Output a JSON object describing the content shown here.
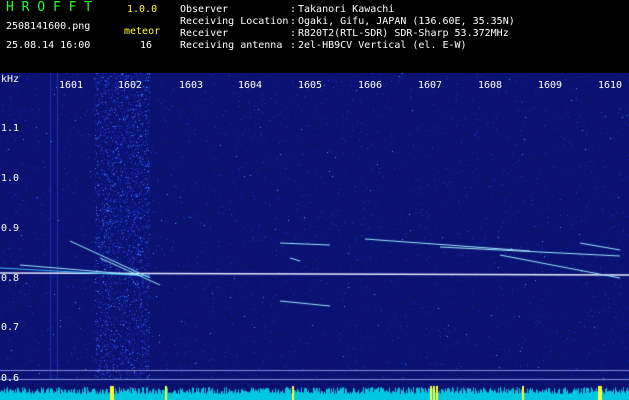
{
  "header": {
    "app_name": "H R O F F T",
    "version": "1.0.0",
    "file_name": "2508141600.png",
    "date_time": "25.08.14 16:00",
    "meteor_label": "meteor",
    "meteor_count": "16"
  },
  "info": [
    {
      "label": "Observer",
      "value": "Takanori Kawachi"
    },
    {
      "label": "Receiving Location",
      "value": "Ogaki, Gifu, JAPAN (136.60E, 35.35N)"
    },
    {
      "label": "Receiver",
      "value": "R820T2(RTL-SDR) SDR-Sharp 53.372MHz"
    },
    {
      "label": "Receiving antenna",
      "value": "2el-HB9CV Vertical (el. E-W)"
    }
  ],
  "separator": ":",
  "axis": {
    "y_unit": "kHz",
    "x_ticks": [
      "1601",
      "1602",
      "1603",
      "1604",
      "1605",
      "1606",
      "1607",
      "1608",
      "1609",
      "1610"
    ],
    "y_ticks": [
      "1.1",
      "1.0",
      "0.9",
      "0.8",
      "0.7",
      "0.6"
    ]
  },
  "colors": {
    "background": "#000000",
    "title": "#22ff22",
    "accent": "#ffff33",
    "text": "#ffffff",
    "spectrum_base": "#0a1170",
    "signal": "#e8f0ff",
    "noise_floor": "#00c8e0"
  }
}
